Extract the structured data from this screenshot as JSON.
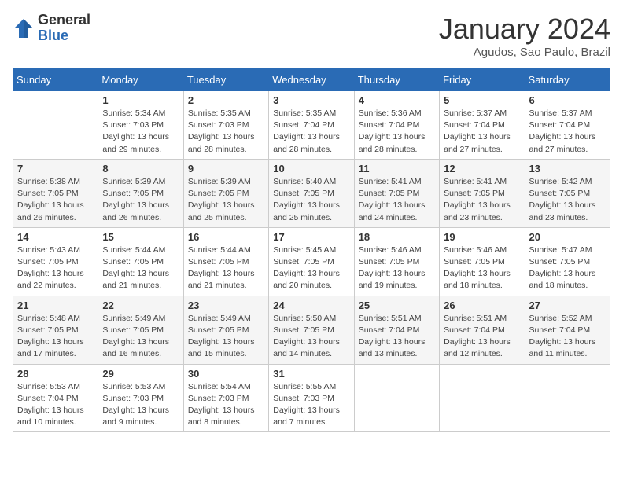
{
  "header": {
    "logo_line1": "General",
    "logo_line2": "Blue",
    "month": "January 2024",
    "location": "Agudos, Sao Paulo, Brazil"
  },
  "weekdays": [
    "Sunday",
    "Monday",
    "Tuesday",
    "Wednesday",
    "Thursday",
    "Friday",
    "Saturday"
  ],
  "weeks": [
    [
      {
        "day": "",
        "info": ""
      },
      {
        "day": "1",
        "info": "Sunrise: 5:34 AM\nSunset: 7:03 PM\nDaylight: 13 hours\nand 29 minutes."
      },
      {
        "day": "2",
        "info": "Sunrise: 5:35 AM\nSunset: 7:03 PM\nDaylight: 13 hours\nand 28 minutes."
      },
      {
        "day": "3",
        "info": "Sunrise: 5:35 AM\nSunset: 7:04 PM\nDaylight: 13 hours\nand 28 minutes."
      },
      {
        "day": "4",
        "info": "Sunrise: 5:36 AM\nSunset: 7:04 PM\nDaylight: 13 hours\nand 28 minutes."
      },
      {
        "day": "5",
        "info": "Sunrise: 5:37 AM\nSunset: 7:04 PM\nDaylight: 13 hours\nand 27 minutes."
      },
      {
        "day": "6",
        "info": "Sunrise: 5:37 AM\nSunset: 7:04 PM\nDaylight: 13 hours\nand 27 minutes."
      }
    ],
    [
      {
        "day": "7",
        "info": "Sunrise: 5:38 AM\nSunset: 7:05 PM\nDaylight: 13 hours\nand 26 minutes."
      },
      {
        "day": "8",
        "info": "Sunrise: 5:39 AM\nSunset: 7:05 PM\nDaylight: 13 hours\nand 26 minutes."
      },
      {
        "day": "9",
        "info": "Sunrise: 5:39 AM\nSunset: 7:05 PM\nDaylight: 13 hours\nand 25 minutes."
      },
      {
        "day": "10",
        "info": "Sunrise: 5:40 AM\nSunset: 7:05 PM\nDaylight: 13 hours\nand 25 minutes."
      },
      {
        "day": "11",
        "info": "Sunrise: 5:41 AM\nSunset: 7:05 PM\nDaylight: 13 hours\nand 24 minutes."
      },
      {
        "day": "12",
        "info": "Sunrise: 5:41 AM\nSunset: 7:05 PM\nDaylight: 13 hours\nand 23 minutes."
      },
      {
        "day": "13",
        "info": "Sunrise: 5:42 AM\nSunset: 7:05 PM\nDaylight: 13 hours\nand 23 minutes."
      }
    ],
    [
      {
        "day": "14",
        "info": "Sunrise: 5:43 AM\nSunset: 7:05 PM\nDaylight: 13 hours\nand 22 minutes."
      },
      {
        "day": "15",
        "info": "Sunrise: 5:44 AM\nSunset: 7:05 PM\nDaylight: 13 hours\nand 21 minutes."
      },
      {
        "day": "16",
        "info": "Sunrise: 5:44 AM\nSunset: 7:05 PM\nDaylight: 13 hours\nand 21 minutes."
      },
      {
        "day": "17",
        "info": "Sunrise: 5:45 AM\nSunset: 7:05 PM\nDaylight: 13 hours\nand 20 minutes."
      },
      {
        "day": "18",
        "info": "Sunrise: 5:46 AM\nSunset: 7:05 PM\nDaylight: 13 hours\nand 19 minutes."
      },
      {
        "day": "19",
        "info": "Sunrise: 5:46 AM\nSunset: 7:05 PM\nDaylight: 13 hours\nand 18 minutes."
      },
      {
        "day": "20",
        "info": "Sunrise: 5:47 AM\nSunset: 7:05 PM\nDaylight: 13 hours\nand 18 minutes."
      }
    ],
    [
      {
        "day": "21",
        "info": "Sunrise: 5:48 AM\nSunset: 7:05 PM\nDaylight: 13 hours\nand 17 minutes."
      },
      {
        "day": "22",
        "info": "Sunrise: 5:49 AM\nSunset: 7:05 PM\nDaylight: 13 hours\nand 16 minutes."
      },
      {
        "day": "23",
        "info": "Sunrise: 5:49 AM\nSunset: 7:05 PM\nDaylight: 13 hours\nand 15 minutes."
      },
      {
        "day": "24",
        "info": "Sunrise: 5:50 AM\nSunset: 7:05 PM\nDaylight: 13 hours\nand 14 minutes."
      },
      {
        "day": "25",
        "info": "Sunrise: 5:51 AM\nSunset: 7:04 PM\nDaylight: 13 hours\nand 13 minutes."
      },
      {
        "day": "26",
        "info": "Sunrise: 5:51 AM\nSunset: 7:04 PM\nDaylight: 13 hours\nand 12 minutes."
      },
      {
        "day": "27",
        "info": "Sunrise: 5:52 AM\nSunset: 7:04 PM\nDaylight: 13 hours\nand 11 minutes."
      }
    ],
    [
      {
        "day": "28",
        "info": "Sunrise: 5:53 AM\nSunset: 7:04 PM\nDaylight: 13 hours\nand 10 minutes."
      },
      {
        "day": "29",
        "info": "Sunrise: 5:53 AM\nSunset: 7:03 PM\nDaylight: 13 hours\nand 9 minutes."
      },
      {
        "day": "30",
        "info": "Sunrise: 5:54 AM\nSunset: 7:03 PM\nDaylight: 13 hours\nand 8 minutes."
      },
      {
        "day": "31",
        "info": "Sunrise: 5:55 AM\nSunset: 7:03 PM\nDaylight: 13 hours\nand 7 minutes."
      },
      {
        "day": "",
        "info": ""
      },
      {
        "day": "",
        "info": ""
      },
      {
        "day": "",
        "info": ""
      }
    ]
  ]
}
